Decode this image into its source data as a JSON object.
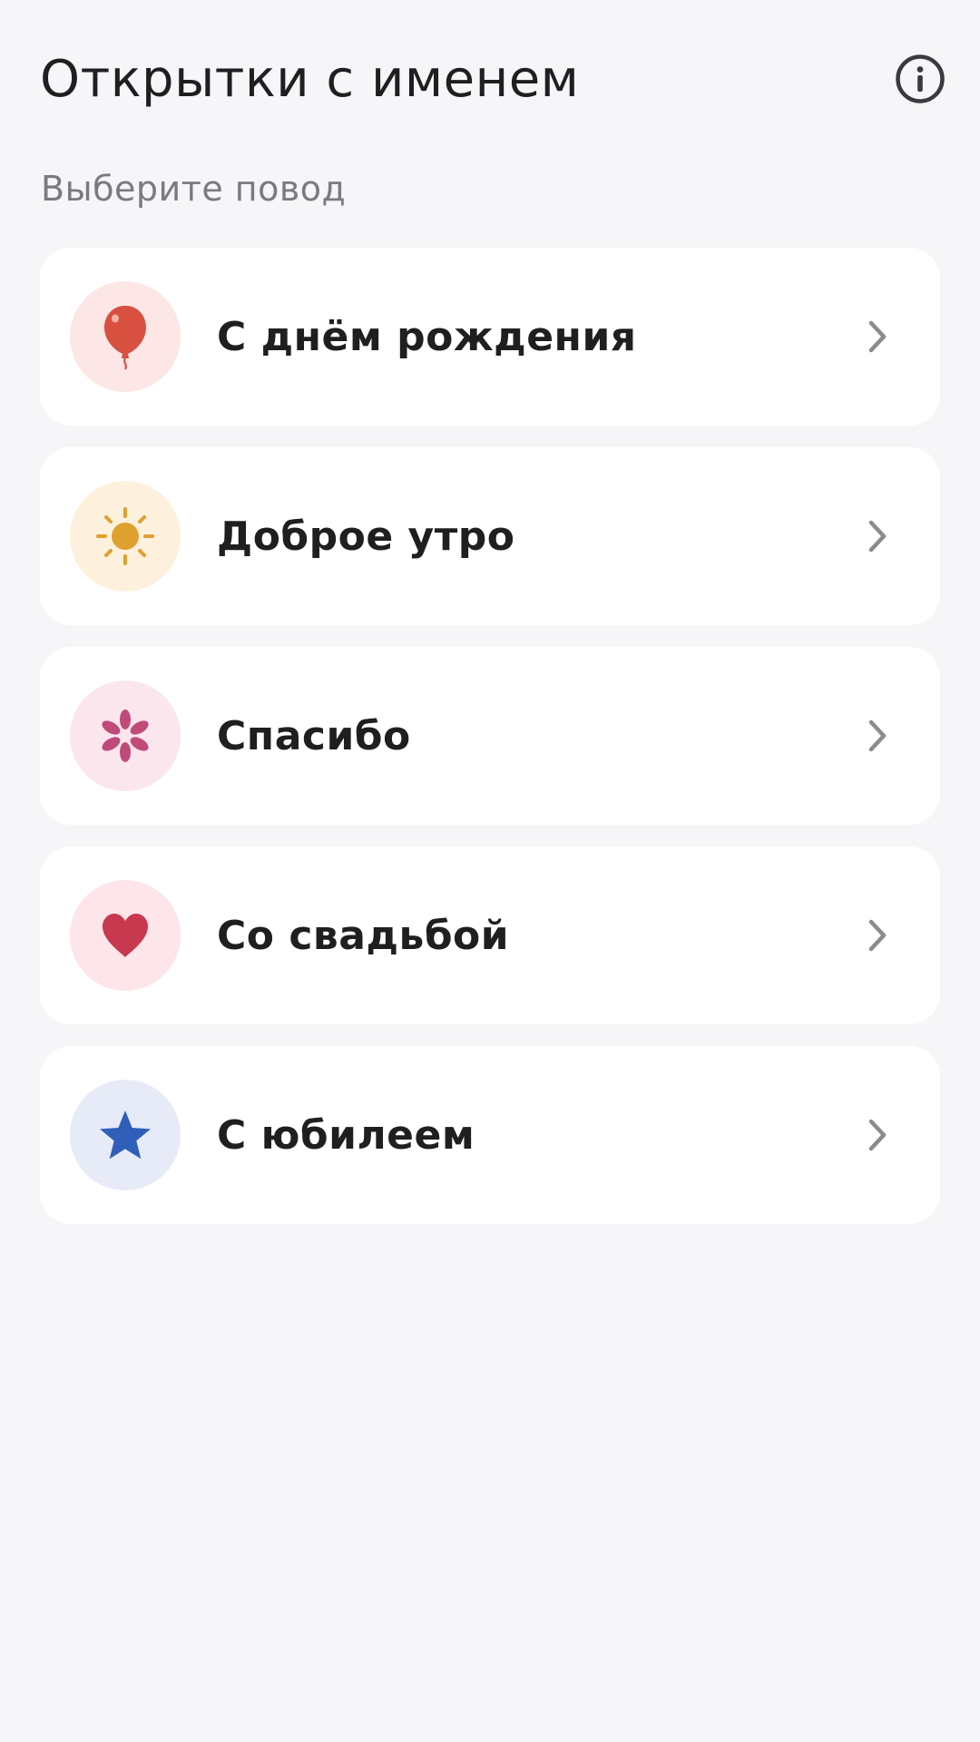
{
  "header": {
    "title": "Открытки с именем",
    "info_icon": "info-icon"
  },
  "subtitle": "Выберите повод",
  "occasions": [
    {
      "label": "С днём рождения",
      "icon": "balloon-icon",
      "bg_color": "#fce7e6",
      "icon_color": "#d8503f"
    },
    {
      "label": "Доброе утро",
      "icon": "sun-icon",
      "bg_color": "#fdf1dd",
      "icon_color": "#e0a030"
    },
    {
      "label": "Спасибо",
      "icon": "flower-icon",
      "bg_color": "#fbe6ee",
      "icon_color": "#c04a7a"
    },
    {
      "label": "Со свадьбой",
      "icon": "heart-icon",
      "bg_color": "#fde5ea",
      "icon_color": "#c8384e"
    },
    {
      "label": "С юбилеем",
      "icon": "star-icon",
      "bg_color": "#e7ebf8",
      "icon_color": "#2f5fb8"
    }
  ],
  "chevron_color": "#8a8a90"
}
